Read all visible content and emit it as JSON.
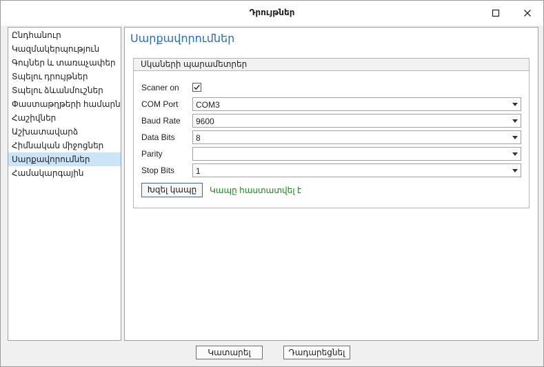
{
  "window": {
    "title": "Դրույթներ",
    "icons": {
      "maximize": "maximize-icon",
      "close": "close-icon"
    }
  },
  "sidebar": {
    "items": [
      {
        "label": "Ընդհանուր"
      },
      {
        "label": "Կազմակերպություն"
      },
      {
        "label": "Գույներ և տառաչափեր"
      },
      {
        "label": "Տպելու դրույթներ"
      },
      {
        "label": "Տպելու ձևանմուշներ"
      },
      {
        "label": "Փաստաթղթերի համարներ"
      },
      {
        "label": "Հաշիվներ"
      },
      {
        "label": "Աշխատավարձ"
      },
      {
        "label": "Հիմնական միջոցներ"
      },
      {
        "label": "Սարքավորումներ",
        "selected": true
      },
      {
        "label": "Համակարգային"
      }
    ]
  },
  "main": {
    "title": "Սարքավորումներ",
    "group": {
      "title": "Սկաների պարամետրեր",
      "scanner_on": {
        "label": "Scaner on",
        "checked": true
      },
      "fields": [
        {
          "label": "COM Port",
          "value": "COM3"
        },
        {
          "label": "Baud Rate",
          "value": "9600"
        },
        {
          "label": "Data Bits",
          "value": "8"
        },
        {
          "label": "Parity",
          "value": ""
        },
        {
          "label": "Stop Bits",
          "value": "1"
        }
      ],
      "connect_button": "Խզել կապը",
      "status": "Կապը հաստատվել է"
    }
  },
  "footer": {
    "ok": "Կատարել",
    "cancel": "Դադարեցնել"
  },
  "colors": {
    "accent": "#2b6cb5",
    "selected_bg": "#cce4f7",
    "status_ok": "#1a8a1a"
  }
}
